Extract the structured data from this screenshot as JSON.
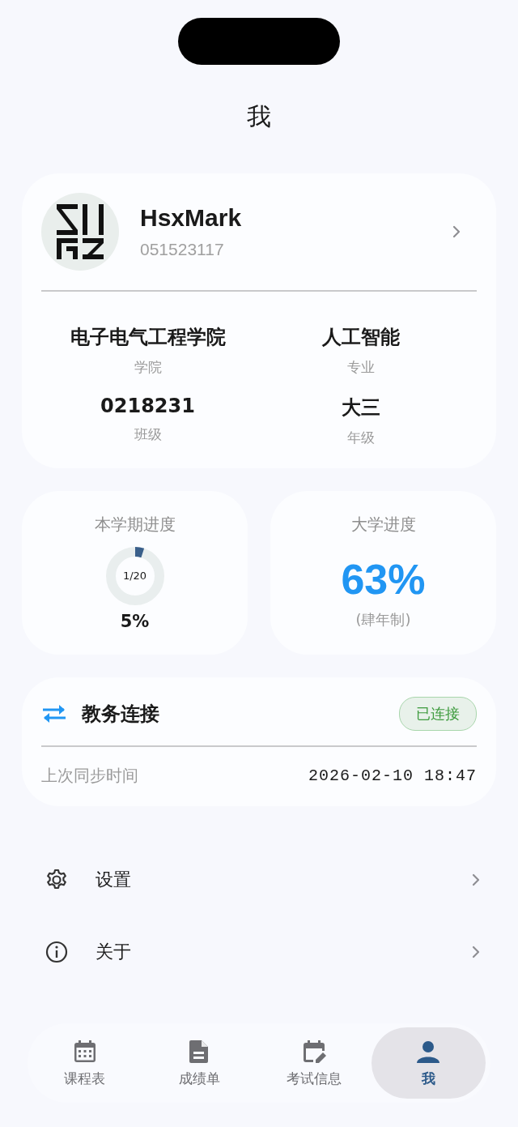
{
  "title": "我",
  "profile": {
    "name": "HsxMark",
    "student_id": "051523117",
    "fields": [
      {
        "value": "电子电气工程学院",
        "label": "学院"
      },
      {
        "value": "人工智能",
        "label": "专业"
      },
      {
        "value": "0218231",
        "label": "班级"
      },
      {
        "value": "大三",
        "label": "年级"
      }
    ]
  },
  "semester_progress": {
    "title": "本学期进度",
    "week": "1/20",
    "percent": "5%"
  },
  "university_progress": {
    "title": "大学进度",
    "percent": "63%",
    "note": "(肆年制)"
  },
  "connection": {
    "title": "教务连接",
    "status": "已连接",
    "connected": true,
    "sync_label": "上次同步时间",
    "sync_time": "2026-02-10 18:47"
  },
  "menu": [
    {
      "kind": "settings",
      "label": "设置"
    },
    {
      "kind": "about",
      "label": "关于"
    }
  ],
  "tabs": [
    {
      "kind": "schedule",
      "label": "课程表",
      "selected": false
    },
    {
      "kind": "grades",
      "label": "成绩单",
      "selected": false
    },
    {
      "kind": "exams",
      "label": "考试信息",
      "selected": false
    },
    {
      "kind": "me",
      "label": "我",
      "selected": true
    }
  ]
}
